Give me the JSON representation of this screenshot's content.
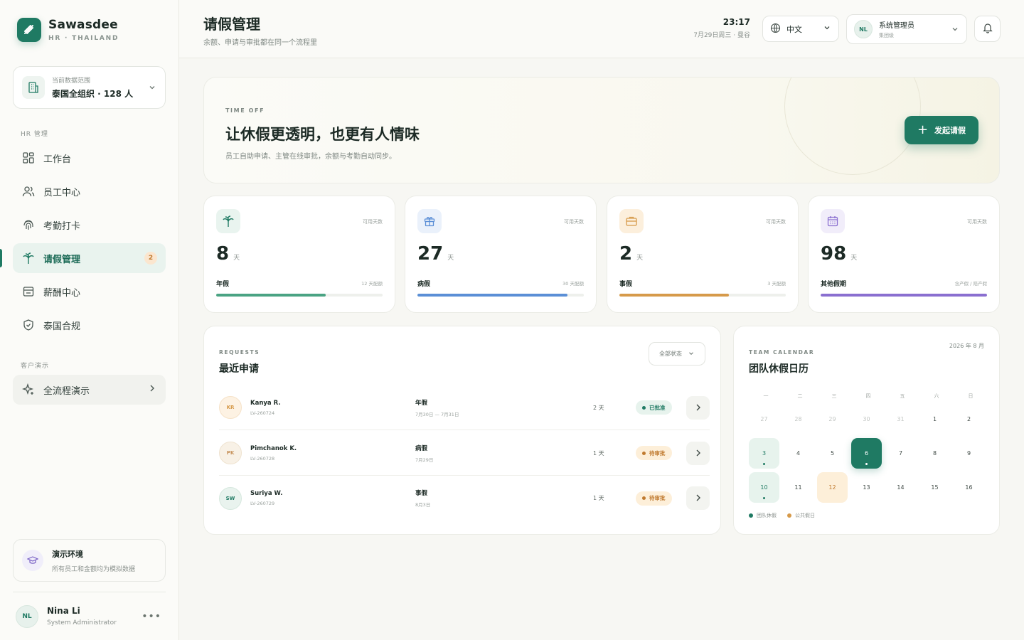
{
  "brand": {
    "name": "Sawasdee",
    "sub": "HR · THAILAND"
  },
  "scope": {
    "label": "当前数据范围",
    "value": "泰国全组织 · 128 人"
  },
  "sidebar": {
    "section_hr": "HR 管理",
    "items": [
      {
        "label": "工作台",
        "icon": "dashboard-icon"
      },
      {
        "label": "员工中心",
        "icon": "users-icon"
      },
      {
        "label": "考勤打卡",
        "icon": "fingerprint-icon"
      },
      {
        "label": "请假管理",
        "icon": "palm-icon",
        "badge": "2"
      },
      {
        "label": "薪酬中心",
        "icon": "payroll-icon"
      },
      {
        "label": "泰国合规",
        "icon": "shield-icon"
      }
    ],
    "section_demo": "客户演示",
    "demo_item": "全流程演示"
  },
  "env": {
    "title": "演示环境",
    "desc": "所有员工和金额均为模拟数据"
  },
  "user": {
    "initials": "NL",
    "name": "Nina Li",
    "role": "System Administrator"
  },
  "header": {
    "title": "请假管理",
    "subtitle": "余额、申请与审批都在同一个流程里",
    "time": "23:17",
    "date": "7月29日周三 · 曼谷",
    "language": "中文",
    "admin_initials": "NL",
    "admin_name": "系统管理员",
    "admin_role": "集团级"
  },
  "hero": {
    "eyebrow": "TIME OFF",
    "title": "让休假更透明，也更有人情味",
    "desc": "员工自助申请、主管在线审批，余额与考勤自动同步。",
    "button": "发起请假"
  },
  "balances": [
    {
      "label": "可用天数",
      "value": "8",
      "unit": "天",
      "name": "年假",
      "quota": "12 天配额",
      "progress": 0.66,
      "color": "#4aa383",
      "icon_bg": "#e9f4ef"
    },
    {
      "label": "可用天数",
      "value": "27",
      "unit": "天",
      "name": "病假",
      "quota": "30 天配额",
      "progress": 0.9,
      "color": "#5b8fd6",
      "icon_bg": "#eaf1fb"
    },
    {
      "label": "可用天数",
      "value": "2",
      "unit": "天",
      "name": "事假",
      "quota": "3 天配额",
      "progress": 0.66,
      "color": "#d69a4a",
      "icon_bg": "#fcefdc"
    },
    {
      "label": "可用天数",
      "value": "98",
      "unit": "天",
      "name": "其他假期",
      "quota": "含产假 / 陪产假",
      "progress": 1.0,
      "color": "#8a6fd0",
      "icon_bg": "#f1edfa"
    }
  ],
  "requests": {
    "eyebrow": "REQUESTS",
    "title": "最近申请",
    "filter": "全部状态",
    "rows": [
      {
        "initials": "KR",
        "name": "Kanya R.",
        "id": "LV-260724",
        "type": "年假",
        "date": "7月30日 — 7月31日",
        "days": "2 天",
        "status": "已批准",
        "status_kind": "approved"
      },
      {
        "initials": "PK",
        "name": "Pimchanok K.",
        "id": "LV-260728",
        "type": "病假",
        "date": "7月29日",
        "days": "1 天",
        "status": "待审批",
        "status_kind": "pending"
      },
      {
        "initials": "SW",
        "name": "Suriya W.",
        "id": "LV-260729",
        "type": "事假",
        "date": "8月3日",
        "days": "1 天",
        "status": "待审批",
        "status_kind": "pending"
      }
    ]
  },
  "calendar": {
    "eyebrow": "TEAM CALENDAR",
    "title": "团队休假日历",
    "month": "2026 年 8 月",
    "weekdays": [
      "一",
      "二",
      "三",
      "四",
      "五",
      "六",
      "日"
    ],
    "days": [
      {
        "d": "27",
        "k": "muted"
      },
      {
        "d": "28",
        "k": "muted"
      },
      {
        "d": "29",
        "k": "muted"
      },
      {
        "d": "30",
        "k": "muted"
      },
      {
        "d": "31",
        "k": "muted"
      },
      {
        "d": "1",
        "k": ""
      },
      {
        "d": "2",
        "k": ""
      },
      {
        "d": "3",
        "k": "team"
      },
      {
        "d": "4",
        "k": ""
      },
      {
        "d": "5",
        "k": ""
      },
      {
        "d": "6",
        "k": "today"
      },
      {
        "d": "7",
        "k": ""
      },
      {
        "d": "8",
        "k": ""
      },
      {
        "d": "9",
        "k": ""
      },
      {
        "d": "10",
        "k": "team"
      },
      {
        "d": "11",
        "k": ""
      },
      {
        "d": "12",
        "k": "holiday"
      },
      {
        "d": "13",
        "k": ""
      },
      {
        "d": "14",
        "k": ""
      },
      {
        "d": "15",
        "k": ""
      },
      {
        "d": "16",
        "k": ""
      }
    ],
    "legend_team": "团队休假",
    "legend_holiday": "公共假日",
    "colors": {
      "team": "#1f7a63",
      "holiday": "#d69a4a"
    }
  }
}
